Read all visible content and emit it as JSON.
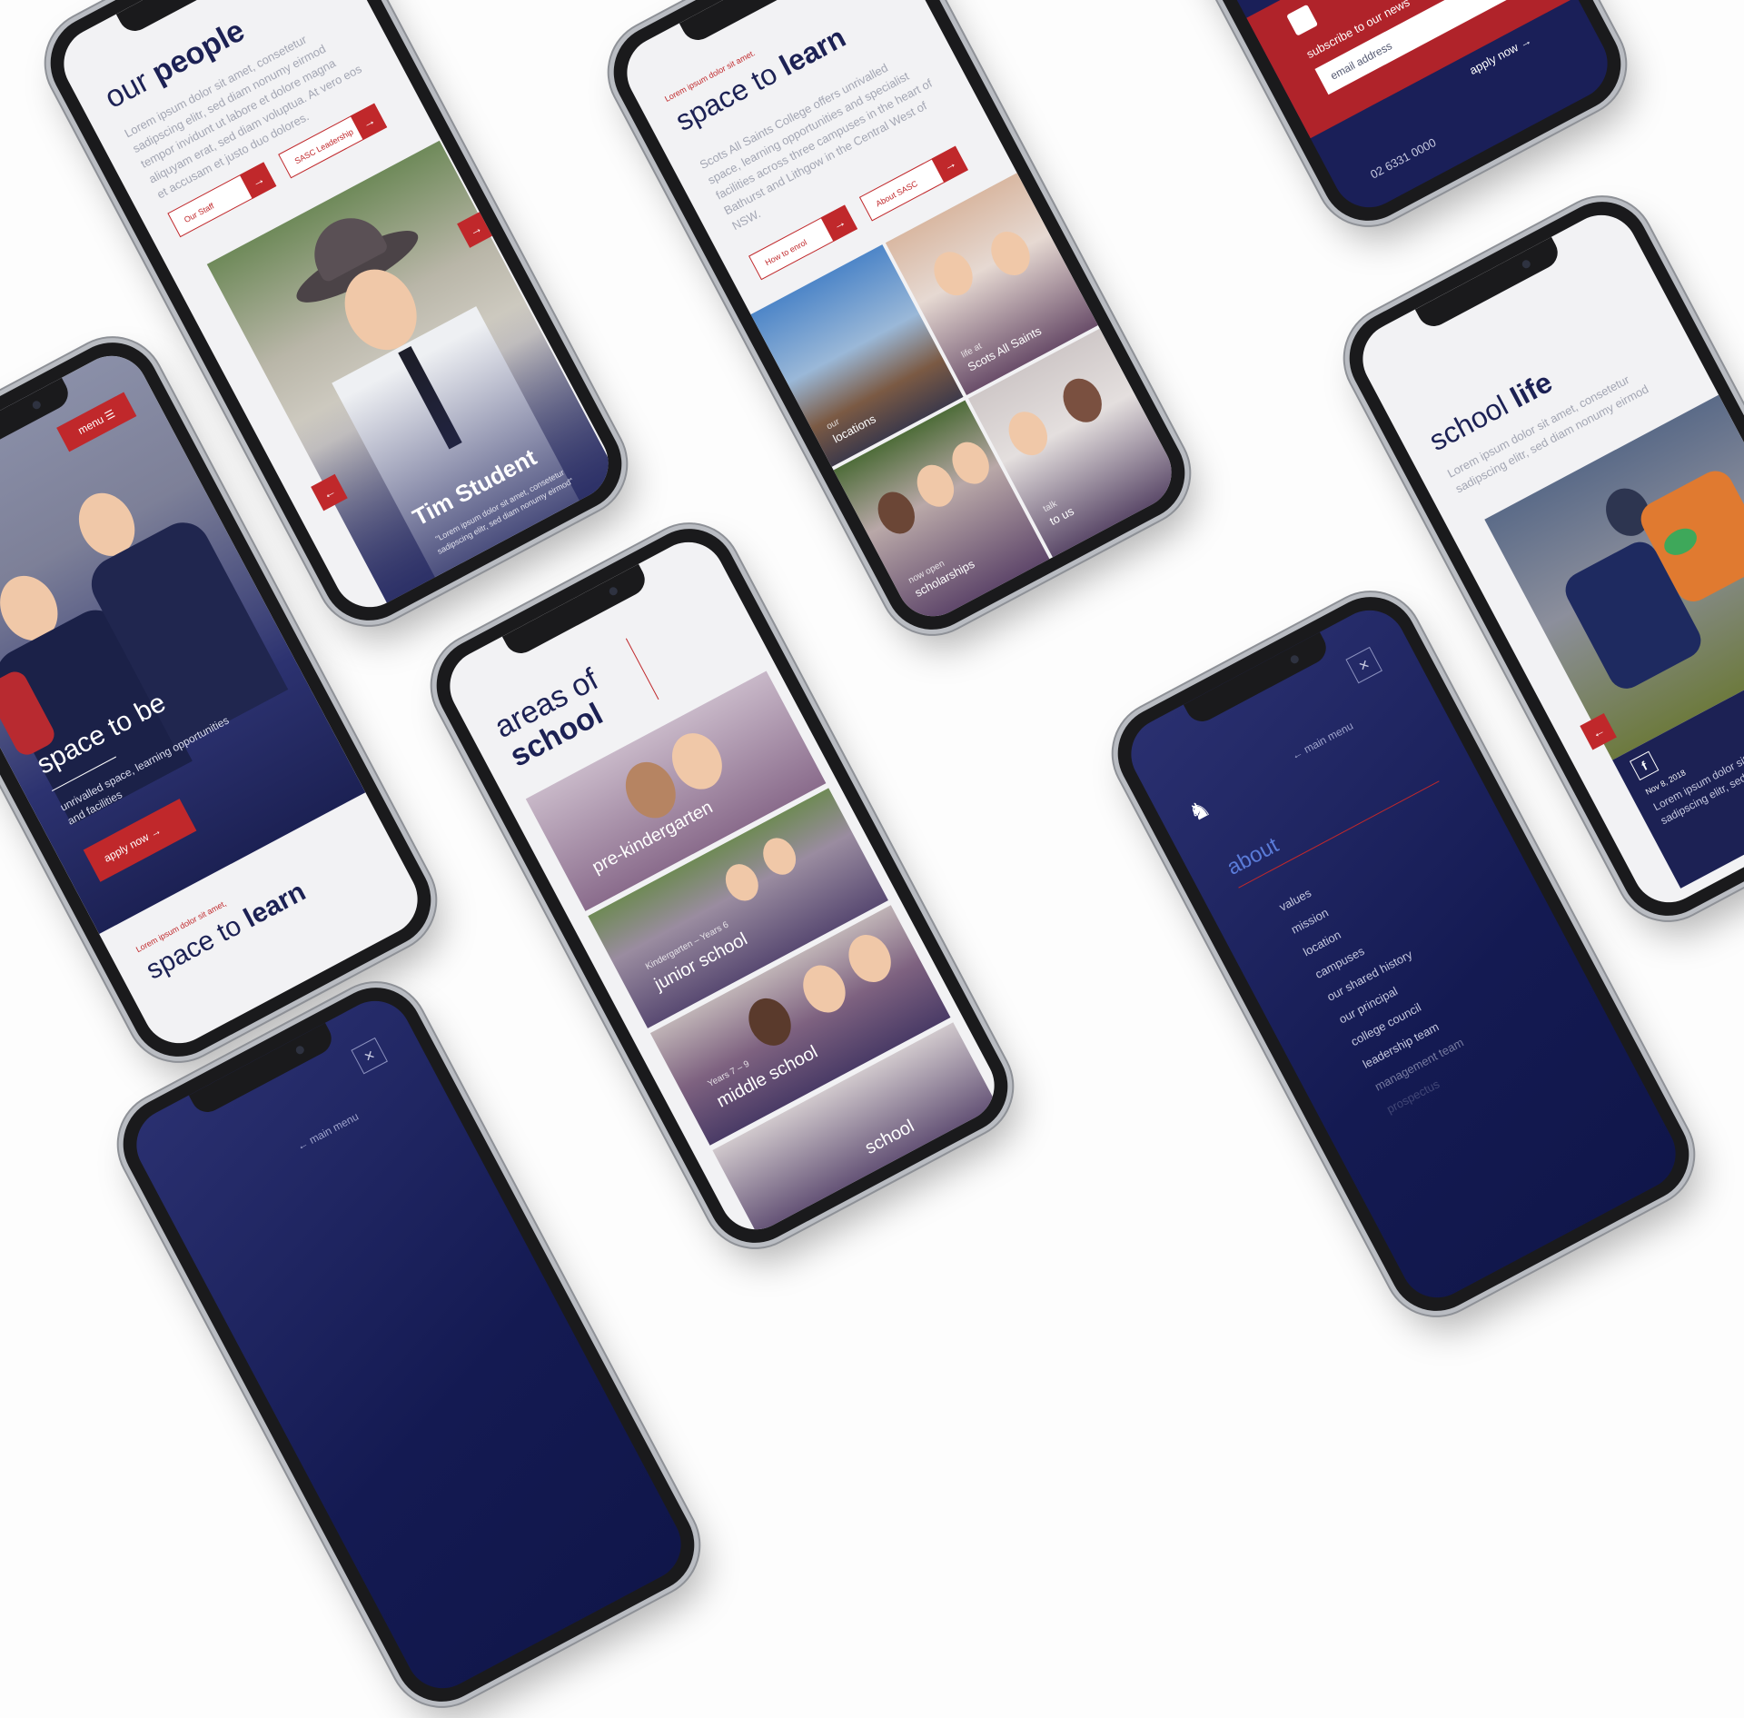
{
  "colors": {
    "navy": "#1c2154",
    "red": "#c0282b",
    "bg": "#fdfdfd"
  },
  "phone_people": {
    "title_thin": "our",
    "title_bold": "people",
    "body": "Lorem ipsum dolor sit amet, consetetur sadipscing elitr, sed diam nonumy eirmod tempor invidunt ut labore et dolore magna aliquyam erat, sed diam voluptua. At vero eos et accusam et justo duo dolores.",
    "btn_staff": "Our Staff",
    "btn_leadership": "SASC Leadership",
    "student_name": "Tim Student",
    "student_quote": "\"Lorem ipsum dolor sit amet, consetetur sadipscing elitr, sed diam nonumy eirmod\"",
    "arrow_left_icon": "arrow-left-icon",
    "arrow_right_icon": "arrow-right-icon"
  },
  "phone_learn": {
    "kicker": "Lorem ipsum dolor sit amet.",
    "title_thin": "space to",
    "title_bold": "learn",
    "body": "Scots All Saints College offers unrivalled space, learning opportunities and specialist facilities across three campuses in the heart of Bathurst and Lithgow in the Central West of NSW.",
    "btn_enrol": "How to enrol",
    "btn_about": "About SASC",
    "tiles": [
      {
        "small": "our",
        "label": "locations"
      },
      {
        "small": "life at",
        "label": "Scots All Saints"
      },
      {
        "small": "now open",
        "label": "scholarships"
      },
      {
        "small": "talk",
        "label": "to us"
      }
    ]
  },
  "phone_subscribe": {
    "heading": "subscribe to our news",
    "email_placeholder": "email address",
    "apply": "apply now",
    "phone": "02 6331 0000"
  },
  "phone_be": {
    "menu": "menu",
    "title": "space to be",
    "sub": "unrivalled space, learning opportunities and facilities",
    "apply": "apply now",
    "kicker": "Lorem ipsum dolor sit amet,",
    "next_thin": "space to",
    "next_bold": "learn"
  },
  "phone_areas": {
    "title_thin": "areas of",
    "title_bold": "school",
    "tiles": [
      {
        "small": "",
        "label": "pre-kindergarten"
      },
      {
        "small": "Kindergarten – Years 6",
        "label": "junior school"
      },
      {
        "small": "Years 7 – 9",
        "label": "middle school"
      },
      {
        "small": "",
        "label": "school"
      }
    ]
  },
  "phone_life": {
    "title_thin": "school",
    "title_bold": "life",
    "body": "Lorem ipsum dolor sit amet, consetetur sadipscing elitr, sed diam nonumy eirmod",
    "date": "Nov 8, 2018",
    "post": "Lorem ipsum dolor sit amet, consetetur sadipscing elitr, sed diam nonumy eirmod",
    "facebook_icon": "facebook-icon"
  },
  "phone_menu": {
    "back": "main menu",
    "section": "about",
    "items": [
      "values",
      "mission",
      "location",
      "campuses",
      "our shared history",
      "our principal",
      "college council",
      "leadership team",
      "management team",
      "prospectus"
    ],
    "close_icon": "close-icon",
    "logo_icon": "lion-crest-icon"
  },
  "phone_menu_small": {
    "back": "main menu",
    "close_icon": "close-icon"
  }
}
